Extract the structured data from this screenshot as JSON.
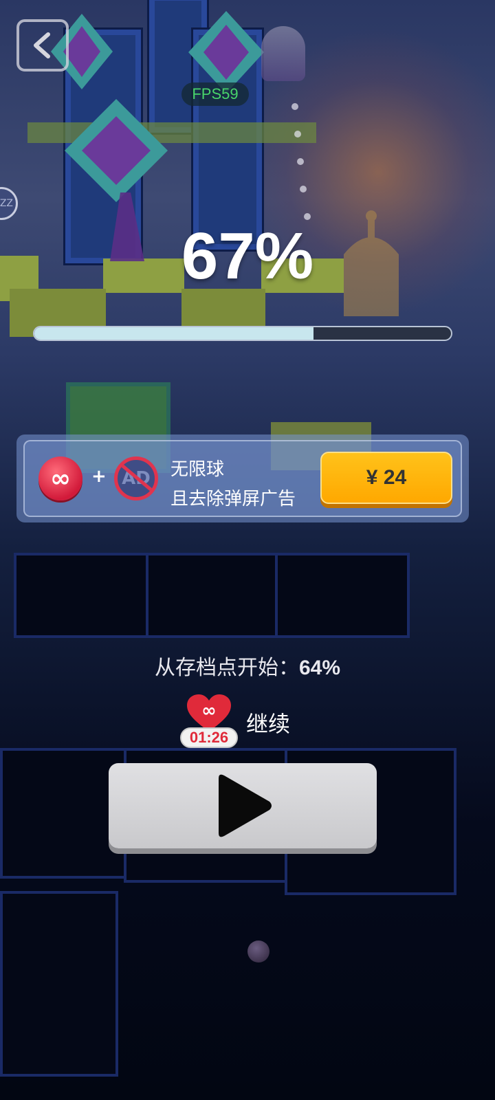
{
  "hud": {
    "fps": "FPS59",
    "side_ball_label": "ZZ",
    "percent": "67%",
    "progress_fraction": 0.67
  },
  "promo": {
    "title": "无限球",
    "subtitle": "且去除弹屏广告",
    "plus": "+",
    "ad_label": "AD",
    "price": "¥ 24"
  },
  "continue": {
    "checkpoint_text": "从存档点开始：",
    "checkpoint_value": "64%",
    "timer": "01:26",
    "label": "继续"
  },
  "icons": {
    "back": "back-arrow-icon",
    "infinity": "infinity-icon",
    "no_ad": "no-ad-icon",
    "heart": "heart-infinity-icon",
    "play": "play-icon"
  },
  "colors": {
    "buy_button": "#ffb000",
    "progress_fill": "#c8e6ee",
    "fps_text": "#48d46a",
    "timer_text": "#e02a3a"
  }
}
